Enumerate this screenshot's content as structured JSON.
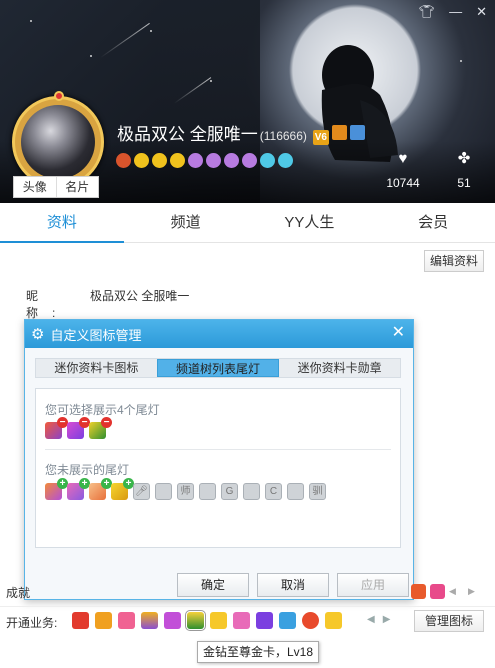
{
  "profile": {
    "display_name": "极品双公 全服唯一",
    "uid": "(116666)",
    "avatar_tabs": [
      "头像",
      "名片"
    ],
    "likes": "10744",
    "fans": "51",
    "vip_badge": "V6"
  },
  "nav_tabs": [
    {
      "label": "资料",
      "active": true
    },
    {
      "label": "频道",
      "active": false
    },
    {
      "label": "YY人生",
      "active": false
    },
    {
      "label": "会员",
      "active": false
    }
  ],
  "edit_button": "编辑资料",
  "nickname": {
    "label": "昵　称:",
    "value": "极品双公 全服唯一"
  },
  "dialog": {
    "title": "自定义图标管理",
    "tabs": [
      {
        "label": "迷你资料卡图标",
        "active": false
      },
      {
        "label": "频道树列表尾灯",
        "active": true
      },
      {
        "label": "迷你资料卡勋章",
        "active": false
      }
    ],
    "shown_title": "您可选择展示4个尾灯",
    "hidden_title": "您未展示的尾灯",
    "grey_icons": [
      "",
      "",
      "师",
      "",
      "G",
      "",
      "C",
      "",
      "驯"
    ],
    "buttons": {
      "ok": "确定",
      "cancel": "取消",
      "apply": "应用"
    }
  },
  "achievements_label": "成就",
  "business": {
    "label": "开通业务:",
    "manage_button": "管理图标",
    "tooltip": "金钻至尊金卡，Lv18"
  },
  "colors": {
    "accent": "#1e8fd6",
    "dialog_header": "#3aa6e0",
    "tab_active": "#52b1e8"
  }
}
